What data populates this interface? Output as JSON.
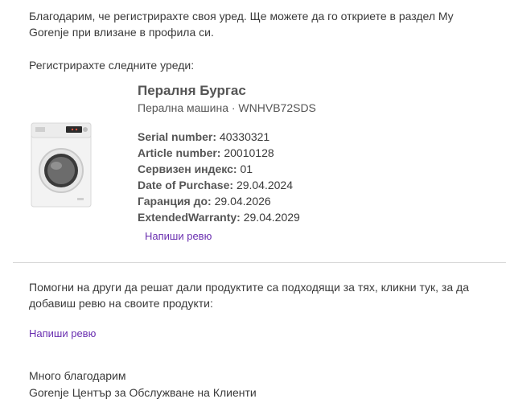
{
  "intro_text": "Благодарим, че регистрирахте своя уред. Ще можете да го откриете в раздел My Gorenje при влизане в профила си.",
  "registered_label": "Регистрирахте следните уреди:",
  "product": {
    "name": "Пералня Бургас",
    "type": "Перална машина · WNHVB72SDS",
    "image": "washing-machine-image",
    "details": [
      {
        "label": "Serial number:",
        "value": "40330321"
      },
      {
        "label": "Article number:",
        "value": "20010128"
      },
      {
        "label": "Сервизен индекс:",
        "value": "01"
      },
      {
        "label": "Date of Purchase:",
        "value": "29.04.2024"
      },
      {
        "label": "Гаранция до:",
        "value": "29.04.2026"
      },
      {
        "label": "ExtendedWarranty:",
        "value": "29.04.2029"
      }
    ],
    "review_link": "Напиши ревю"
  },
  "help_text": "Помогни на други да решат дали продуктите са подходящи за тях, кликни тук, за да добавиш ревю на своите продукти:",
  "review_link": "Напиши ревю",
  "closing": {
    "thanks": "Много благодарим",
    "team": "Gorenje Център за Обслужване на Клиенти"
  },
  "colors": {
    "link": "#6a2fb0",
    "text": "#3a3a3a",
    "divider": "#d6d6d6"
  }
}
